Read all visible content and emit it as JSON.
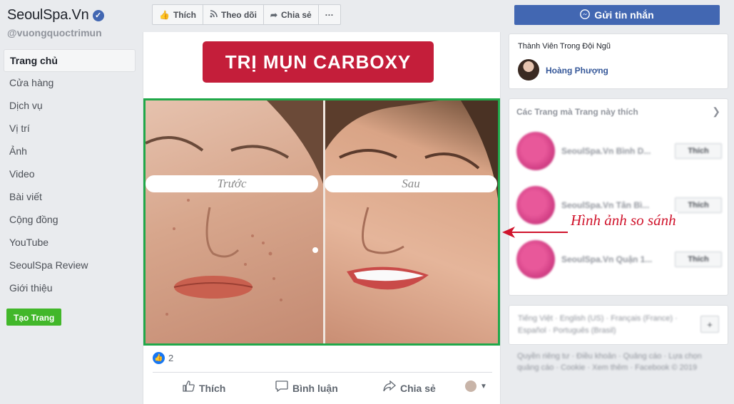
{
  "sidebar": {
    "page_name": "SeoulSpa.Vn",
    "handle": "@vuongquoctrimun",
    "nav": [
      {
        "label": "Trang chủ"
      },
      {
        "label": "Cửa hàng"
      },
      {
        "label": "Dịch vụ"
      },
      {
        "label": "Vị trí"
      },
      {
        "label": "Ảnh"
      },
      {
        "label": "Video"
      },
      {
        "label": "Bài viết"
      },
      {
        "label": "Cộng đồng"
      },
      {
        "label": "YouTube"
      },
      {
        "label": "SeoulSpa Review"
      },
      {
        "label": "Giới thiệu"
      }
    ],
    "create_page": "Tạo Trang"
  },
  "toolbar": {
    "like": "Thích",
    "follow": "Theo dõi",
    "share": "Chia sẻ",
    "more": "···",
    "send_message": "Gửi tin nhắn"
  },
  "post": {
    "banner": "TRỊ MỤN CARBOXY",
    "before_label": "Trước",
    "after_label": "Sau",
    "reaction_count": "2",
    "actions": {
      "like": "Thích",
      "comment": "Bình luận",
      "share": "Chia sẻ"
    }
  },
  "right": {
    "team_title": "Thành Viên Trong Đội Ngũ",
    "team_member": "Hoàng Phượng",
    "liked_title": "Các Trang mà Trang này thích",
    "liked_pages": [
      {
        "name": "SeoulSpa.Vn Bình D...",
        "button": "Thích"
      },
      {
        "name": "SeoulSpa.Vn Tân Bì...",
        "button": "Thích"
      },
      {
        "name": "SeoulSpa.Vn Quận 1...",
        "button": "Thích"
      }
    ],
    "languages": "Tiếng Việt · English (US) · Français (France) · Español · Português (Brasil)",
    "footer": "Quyền riêng tư · Điều khoản · Quảng cáo · Lựa chọn quảng cáo · Cookie · Xem thêm · Facebook © 2019"
  },
  "annotation": {
    "text": "Hình ảnh so sánh",
    "color": "#d0142c"
  },
  "colors": {
    "facebook_blue": "#4267b2",
    "green_border": "#20a84a",
    "banner_red": "#c41e3a",
    "create_green": "#42b72a"
  }
}
